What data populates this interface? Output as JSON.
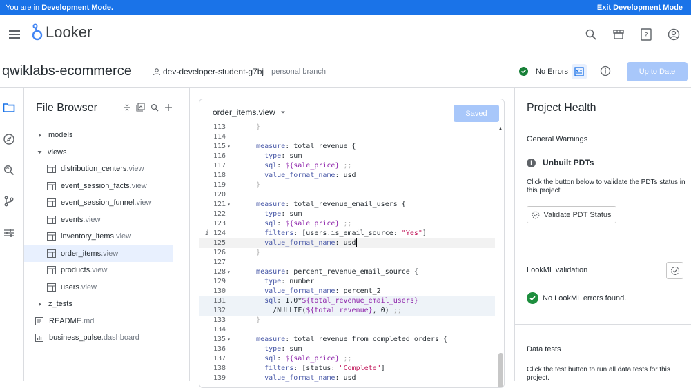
{
  "devbar": {
    "left_prefix": "You are in ",
    "left_bold": "Development Mode.",
    "right": "Exit Development Mode"
  },
  "app": {
    "name": "Looker"
  },
  "project": {
    "name": "qwiklabs-ecommerce",
    "branch": "dev-developer-student-g7bj",
    "branch_type": "personal branch",
    "status": "No Errors",
    "up_to_date_label": "Up to Date"
  },
  "file_browser": {
    "title": "File Browser",
    "items": [
      {
        "name": "models",
        "ext": "",
        "kind": "folder-collapsed"
      },
      {
        "name": "views",
        "ext": "",
        "kind": "folder-open"
      },
      {
        "name": "distribution_centers",
        "ext": ".view",
        "kind": "view"
      },
      {
        "name": "event_session_facts",
        "ext": ".view",
        "kind": "view"
      },
      {
        "name": "event_session_funnel",
        "ext": ".view",
        "kind": "view"
      },
      {
        "name": "events",
        "ext": ".view",
        "kind": "view"
      },
      {
        "name": "inventory_items",
        "ext": ".view",
        "kind": "view"
      },
      {
        "name": "order_items",
        "ext": ".view",
        "kind": "view",
        "selected": true
      },
      {
        "name": "products",
        "ext": ".view",
        "kind": "view"
      },
      {
        "name": "users",
        "ext": ".view",
        "kind": "view"
      },
      {
        "name": "z_tests",
        "ext": "",
        "kind": "folder-collapsed"
      },
      {
        "name": "README",
        "ext": ".md",
        "kind": "doc"
      },
      {
        "name": "business_pulse",
        "ext": ".dashboard",
        "kind": "dashboard"
      }
    ]
  },
  "editor": {
    "filename": "order_items.view",
    "saved_label": "Saved",
    "lines": [
      {
        "n": "113",
        "t": "  }"
      },
      {
        "n": "114",
        "t": ""
      },
      {
        "n": "115",
        "t": "  measure: total_revenue {",
        "fold": true
      },
      {
        "n": "116",
        "t": "    type: sum"
      },
      {
        "n": "117",
        "t": "    sql: ${sale_price} ;;"
      },
      {
        "n": "118",
        "t": "    value_format_name: usd"
      },
      {
        "n": "119",
        "t": "  }"
      },
      {
        "n": "120",
        "t": ""
      },
      {
        "n": "121",
        "t": "  measure: total_revenue_email_users {",
        "fold": true
      },
      {
        "n": "122",
        "t": "    type: sum"
      },
      {
        "n": "123",
        "t": "    sql: ${sale_price} ;;"
      },
      {
        "n": "124",
        "t": "    filters: [users.is_email_source: \"Yes\"]",
        "info": "i"
      },
      {
        "n": "125",
        "t": "    value_format_name: usd",
        "cursor": true
      },
      {
        "n": "126",
        "t": "  }"
      },
      {
        "n": "127",
        "t": ""
      },
      {
        "n": "128",
        "t": "  measure: percent_revenue_email_source {",
        "fold": true
      },
      {
        "n": "129",
        "t": "    type: number"
      },
      {
        "n": "130",
        "t": "    value_format_name: percent_2"
      },
      {
        "n": "131",
        "t": "    sql: 1.0*${total_revenue_email_users}",
        "hl": true
      },
      {
        "n": "132",
        "t": "      /NULLIF(${total_revenue}, 0) ;;",
        "hl": true
      },
      {
        "n": "133",
        "t": "  }"
      },
      {
        "n": "134",
        "t": ""
      },
      {
        "n": "135",
        "t": "  measure: total_revenue_from_completed_orders {",
        "fold": true
      },
      {
        "n": "136",
        "t": "    type: sum"
      },
      {
        "n": "137",
        "t": "    sql: ${sale_price} ;;"
      },
      {
        "n": "138",
        "t": "    filters: [status: \"Complete\"]"
      },
      {
        "n": "139",
        "t": "    value_format_name: usd"
      }
    ]
  },
  "health": {
    "title": "Project Health",
    "general_warnings": "General Warnings",
    "unbuilt_title": "Unbuilt PDTs",
    "unbuilt_desc": "Click the button below to validate the PDTs status in this project",
    "validate_pdt_label": "Validate PDT Status",
    "lookml_validation": "LookML validation",
    "lookml_ok": "No LookML errors found.",
    "data_tests": "Data tests",
    "data_tests_desc": "Click the test button to run all data tests for this project."
  }
}
